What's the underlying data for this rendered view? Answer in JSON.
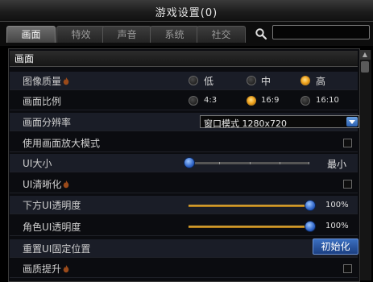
{
  "window": {
    "title": "游戏设置(0)"
  },
  "tabs": [
    {
      "label": "画面",
      "active": true
    },
    {
      "label": "特效",
      "active": false
    },
    {
      "label": "声音",
      "active": false
    },
    {
      "label": "系统",
      "active": false
    },
    {
      "label": "社交",
      "active": false
    }
  ],
  "search": {
    "icon": "search-icon",
    "value": "",
    "placeholder": ""
  },
  "section": {
    "title": "画面"
  },
  "settings": {
    "image_quality": {
      "label": "图像质量",
      "options": [
        "低",
        "中",
        "高"
      ],
      "selected": "高"
    },
    "aspect_ratio": {
      "label": "画面比例",
      "options": [
        "4:3",
        "16:9",
        "16:10"
      ],
      "selected": "16:9"
    },
    "resolution": {
      "label": "画面分辨率",
      "value": "窗口模式 1280x720"
    },
    "zoom_mode": {
      "label": "使用画面放大模式",
      "checked": false
    },
    "ui_size": {
      "label": "UI大小",
      "value_text": "最小",
      "level": 0
    },
    "ui_sharpen": {
      "label": "UI清晰化",
      "checked": false
    },
    "bottom_ui_opacity": {
      "label": "下方UI透明度",
      "value_text": "100%",
      "level": 1.0
    },
    "character_ui_opacity": {
      "label": "角色UI透明度",
      "value_text": "100%",
      "level": 1.0
    },
    "reset_ui": {
      "label": "重置UI固定位置",
      "button": "初始化"
    },
    "quality_boost": {
      "label": "画质提升",
      "checked": false
    }
  },
  "colors": {
    "accent_orange": "#f0a21a",
    "slider_blue": "#2f64c7",
    "button_blue": "#2a58a8"
  }
}
